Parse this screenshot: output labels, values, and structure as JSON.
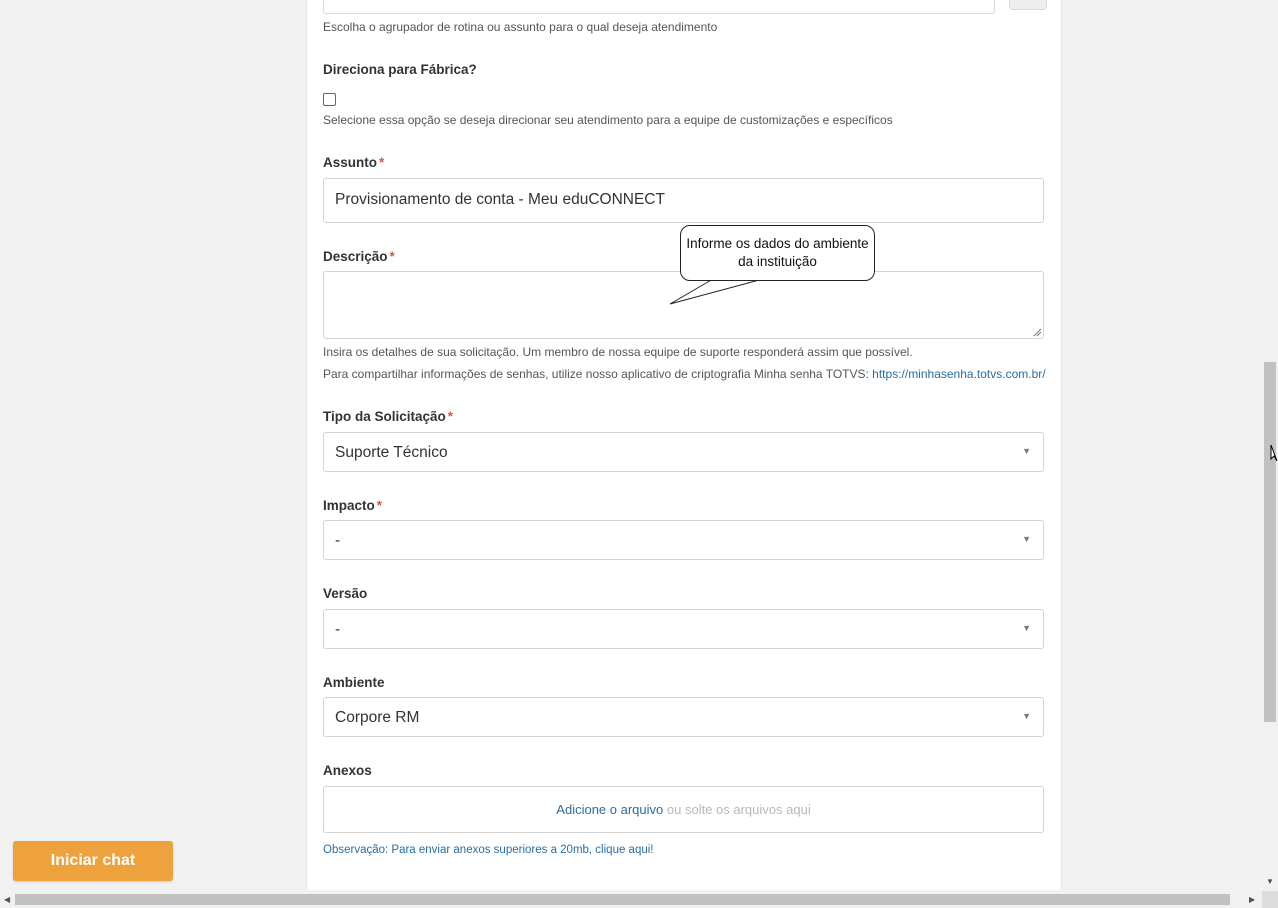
{
  "form": {
    "topic_hint": "Escolha o agrupador de rotina ou assunto para o qual deseja atendimento",
    "factory": {
      "label": "Direciona para Fábrica?",
      "checked": false,
      "hint": "Selecione essa opção se deseja direcionar seu atendimento para a equipe de customizações e específicos"
    },
    "subject": {
      "label": "Assunto",
      "required_mark": "*",
      "value": "Provisionamento de conta - Meu eduCONNECT"
    },
    "description": {
      "label": "Descrição",
      "required_mark": "*",
      "value": "",
      "hint1": "Insira os detalhes de sua solicitação. Um membro de nossa equipe de suporte responderá assim que possível.",
      "hint2_prefix": "Para compartilhar informações de senhas, utilize nosso aplicativo de criptografia Minha senha TOTVS: ",
      "hint2_link": "https://minhasenha.totvs.com.br/"
    },
    "request_type": {
      "label": "Tipo da Solicitação",
      "required_mark": "*",
      "value": "Suporte Técnico"
    },
    "impact": {
      "label": "Impacto",
      "required_mark": "*",
      "value": "-"
    },
    "version": {
      "label": "Versão",
      "value": "-"
    },
    "environment": {
      "label": "Ambiente",
      "value": "Corpore RM"
    },
    "attachments": {
      "label": "Anexos",
      "add_link": "Adicione o arquivo",
      "drop_text": "ou solte os arquivos aqui",
      "note": "Observação: Para enviar anexos superiores a 20mb, clique aqui!"
    }
  },
  "callout": {
    "line1": "Informe os dados do ambiente",
    "line2": "da instituição"
  },
  "chat": {
    "label": "Iniciar chat"
  },
  "icons": {
    "dropdown": "▼",
    "scroll_left": "◀",
    "scroll_right": "▶",
    "scroll_down": "▼"
  },
  "colors": {
    "chat_button": "#eda23d",
    "link": "#2b6ca3",
    "required": "#d9534f"
  }
}
